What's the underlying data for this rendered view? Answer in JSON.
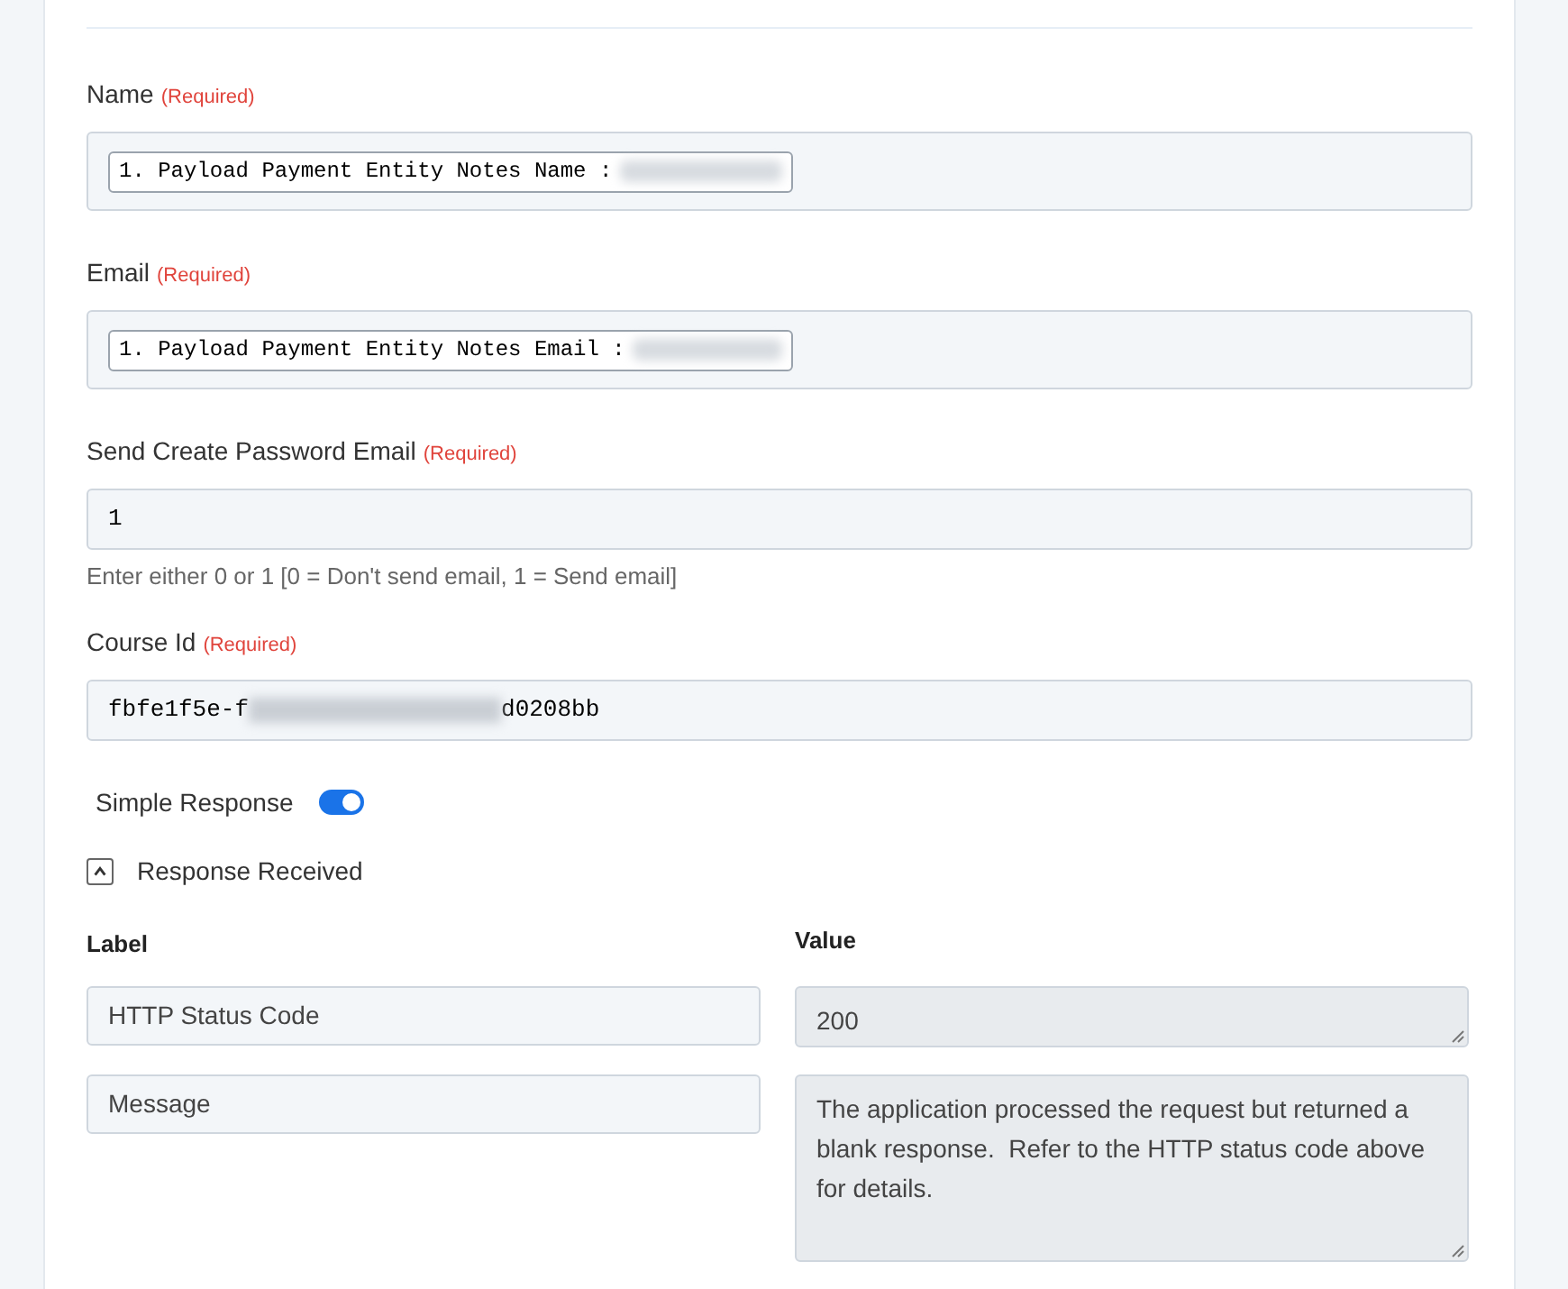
{
  "fields": [
    {
      "label": "Name",
      "required": "(Required)",
      "kind": "chip",
      "value": "1. Payload Payment Entity Notes Name :",
      "redacted": true
    },
    {
      "label": "Email",
      "required": "(Required)",
      "kind": "chip",
      "value": "1. Payload Payment Entity Notes Email :",
      "redacted": true
    },
    {
      "label": "Send Create Password Email",
      "required": "(Required)",
      "kind": "text",
      "value": "1",
      "hint": "Enter either 0 or 1 [0 = Don't send email, 1 = Send email]"
    },
    {
      "label": "Course Id",
      "required": "(Required)",
      "kind": "text",
      "value": "fbfe1f5e-f",
      "redacted": true,
      "value_end": "d0208bb"
    }
  ],
  "simple_response": {
    "label": "Simple Response",
    "on": true
  },
  "response_received": {
    "label": "Response Received",
    "expanded": true
  },
  "table": {
    "columns": [
      "Label",
      "Value"
    ],
    "rows": [
      {
        "label": "HTTP Status Code",
        "value": "200"
      },
      {
        "label": "Message",
        "value": "The application processed the request but returned a blank response.  Refer to the HTTP status code above for details."
      }
    ]
  }
}
